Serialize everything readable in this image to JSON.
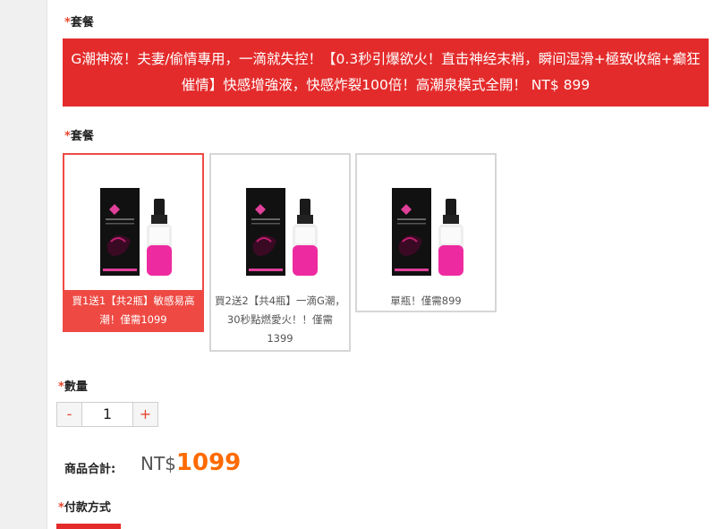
{
  "required_mark": "*",
  "package_label_1": "套餐",
  "selected_package_title": "G潮神液！夫妻/偷情專用，一滴就失控！【0.3秒引爆欲火！直击神经末梢，瞬间湿滑+極致收縮+癫狂催情】快感增強液，快感炸裂100倍！高潮泉模式全開！ NT$ 899",
  "package_label_2": "套餐",
  "options": [
    {
      "caption": "買1送1【共2瓶】敏感易高潮！僅需1099",
      "selected": true
    },
    {
      "caption": "買2送2【共4瓶】一滴G潮，30秒點燃愛火！！僅需1399",
      "selected": false
    },
    {
      "caption": "單瓶！僅需899",
      "selected": false
    }
  ],
  "quantity_label": "數量",
  "quantity": {
    "minus": "-",
    "value": "1",
    "plus": "+"
  },
  "total_label": "商品合計:",
  "total_currency": "NT$",
  "total_amount": "1099",
  "payment_label": "付款方式",
  "colors": {
    "accent": "#e42b2b",
    "selected": "#ee4a43",
    "price": "#ff6a00"
  }
}
